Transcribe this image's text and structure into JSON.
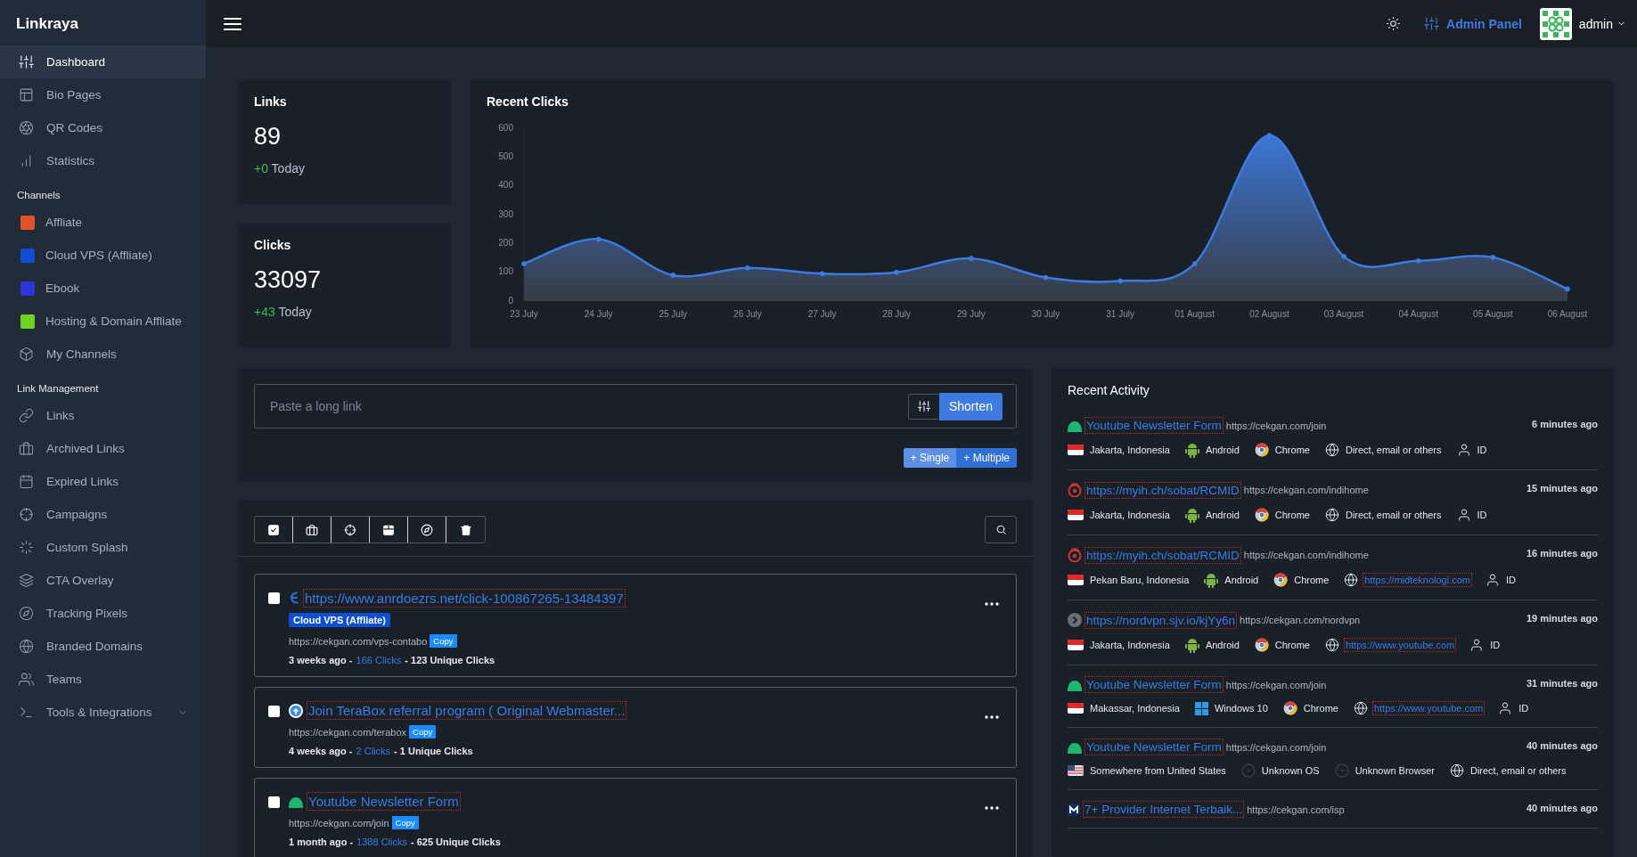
{
  "sidebar": {
    "brand": "Linkraya",
    "groups": [
      {
        "items": [
          {
            "label": "Dashboard",
            "kind": "sliders",
            "selected": true
          },
          {
            "label": "Bio Pages",
            "kind": "layout",
            "selected": false
          },
          {
            "label": "QR Codes",
            "kind": "aperture",
            "selected": false
          },
          {
            "label": "Statistics",
            "kind": "bar-chart",
            "selected": false
          }
        ]
      },
      {
        "heading": "Channels",
        "items": [
          {
            "label": "Affliate",
            "kind": "channel",
            "color": "#e0542a",
            "selected": false
          },
          {
            "label": "Cloud VPS (Affliate)",
            "kind": "channel",
            "color": "#0c4fd6",
            "selected": false
          },
          {
            "label": "Ebook",
            "kind": "channel",
            "color": "#2b35d8",
            "selected": false
          },
          {
            "label": "Hosting & Domain Affliate",
            "kind": "channel",
            "color": "#6ed321",
            "selected": false
          },
          {
            "label": "My Channels",
            "kind": "box",
            "selected": false
          }
        ]
      },
      {
        "heading": "Link Management",
        "items": [
          {
            "label": "Links",
            "kind": "link",
            "selected": false
          },
          {
            "label": "Archived Links",
            "kind": "briefcase",
            "selected": false
          },
          {
            "label": "Expired Links",
            "kind": "calendar",
            "selected": false
          },
          {
            "label": "Campaigns",
            "kind": "crosshair",
            "selected": false
          },
          {
            "label": "Custom Splash",
            "kind": "loader",
            "selected": false
          },
          {
            "label": "CTA Overlay",
            "kind": "layers",
            "selected": false
          },
          {
            "label": "Tracking Pixels",
            "kind": "compass",
            "selected": false
          },
          {
            "label": "Branded Domains",
            "kind": "globe",
            "selected": false
          },
          {
            "label": "Teams",
            "kind": "users",
            "selected": false
          },
          {
            "label": "Tools & Integrations",
            "kind": "terminal",
            "selected": false,
            "expanded": false
          }
        ]
      }
    ]
  },
  "header": {
    "admin_panel": "Admin Panel",
    "user": "admin"
  },
  "stats": [
    {
      "title": "Links",
      "value": "89",
      "delta": "+0",
      "period": "Today"
    },
    {
      "title": "Clicks",
      "value": "33097",
      "delta": "+43",
      "period": "Today"
    }
  ],
  "recent_clicks": {
    "chart_data": {
      "type": "area",
      "title": "Recent Clicks",
      "categories": [
        "23 July",
        "24 July",
        "25 July",
        "26 July",
        "27 July",
        "28 July",
        "29 July",
        "30 July",
        "31 July",
        "01 August",
        "02 August",
        "03 August",
        "04 August",
        "05 August",
        "06 August"
      ],
      "series": [
        {
          "color": "#3d7be0",
          "values": [
            130,
            215,
            90,
            115,
            95,
            100,
            148,
            82,
            70,
            130,
            575,
            155,
            140,
            152,
            42
          ]
        }
      ],
      "ylim": [
        0,
        600
      ],
      "yticks": [
        0,
        100,
        200,
        300,
        400,
        500,
        600
      ]
    }
  },
  "shortener": {
    "placeholder": "Paste a long link",
    "submit": "Shorten",
    "modes": [
      {
        "label": "+ Single",
        "selected": true
      },
      {
        "label": "+ Multiple",
        "selected": false
      }
    ]
  },
  "links": {
    "cards": [
      {
        "checked": false,
        "favicon": {
          "kind": "arc"
        },
        "title": "https://www.anrdoezrs.net/click-100867265-13484397",
        "tag": {
          "label": "Cloud VPS (Affliate)",
          "color": "#0c4fd6"
        },
        "short_url": "https://cekgan.com/vps-contabo",
        "copy": "Copy",
        "time": "3 weeks ago -",
        "clicks": "166 Clicks",
        "unique": "- 123 Unique Clicks"
      },
      {
        "checked": false,
        "favicon": {
          "kind": "cloud"
        },
        "title": "Join TeraBox referral program ( Original Webmaster...",
        "short_url": "https://cekgan.com/terabox",
        "copy": "Copy",
        "time": "4 weeks ago -",
        "clicks": "2 Clicks",
        "unique": "- 1 Unique Clicks"
      },
      {
        "checked": false,
        "favicon": {
          "kind": "dome"
        },
        "title": "Youtube Newsletter Form",
        "short_url": "https://cekgan.com/join",
        "copy": "Copy",
        "time": "1 month ago -",
        "clicks": "1388 Clicks",
        "unique": "- 625 Unique Clicks"
      }
    ]
  },
  "activity": {
    "title": "Recent Activity",
    "rows": [
      {
        "favicon": {
          "kind": "dome"
        },
        "title": "Youtube Newsletter Form",
        "short_url": "https://cekgan.com/join",
        "time": "6 minutes ago",
        "details": [
          {
            "kind": "flag-id",
            "text": "Jakarta, Indonesia"
          },
          {
            "kind": "android",
            "text": "Android"
          },
          {
            "kind": "chrome",
            "text": "Chrome"
          },
          {
            "kind": "referrer",
            "text": "Direct, email or others"
          },
          {
            "kind": "user",
            "text": "ID"
          }
        ]
      },
      {
        "favicon": {
          "kind": "target"
        },
        "title": "https://myih.ch/sobat/RCMID",
        "short_url": "https://cekgan.com/indihome",
        "time": "15 minutes ago",
        "details": [
          {
            "kind": "flag-id",
            "text": "Jakarta, Indonesia"
          },
          {
            "kind": "android",
            "text": "Android"
          },
          {
            "kind": "chrome",
            "text": "Chrome"
          },
          {
            "kind": "referrer",
            "text": "Direct, email or others"
          },
          {
            "kind": "user",
            "text": "ID"
          }
        ]
      },
      {
        "favicon": {
          "kind": "target"
        },
        "title": "https://myih.ch/sobat/RCMID",
        "short_url": "https://cekgan.com/indihome",
        "time": "16 minutes ago",
        "details": [
          {
            "kind": "flag-id",
            "text": "Pekan Baru, Indonesia"
          },
          {
            "kind": "android",
            "text": "Android"
          },
          {
            "kind": "chrome",
            "text": "Chrome"
          },
          {
            "kind": "referrer-link",
            "text": "https://midteknologi.com"
          },
          {
            "kind": "user",
            "text": "ID"
          }
        ]
      },
      {
        "favicon": {
          "kind": "chevron"
        },
        "title": "https://nordvpn.sjv.io/kjYy6n",
        "short_url": "https://cekgan.com/nordvpn",
        "time": "19 minutes ago",
        "details": [
          {
            "kind": "flag-id",
            "text": "Jakarta, Indonesia"
          },
          {
            "kind": "android",
            "text": "Android"
          },
          {
            "kind": "chrome",
            "text": "Chrome"
          },
          {
            "kind": "referrer-link",
            "text": "https://www.youtube.com"
          },
          {
            "kind": "user",
            "text": "ID"
          }
        ]
      },
      {
        "favicon": {
          "kind": "dome"
        },
        "title": "Youtube Newsletter Form",
        "short_url": "https://cekgan.com/join",
        "time": "31 minutes ago",
        "details": [
          {
            "kind": "flag-id",
            "text": "Makassar, Indonesia"
          },
          {
            "kind": "windows",
            "text": "Windows 10"
          },
          {
            "kind": "chrome",
            "text": "Chrome"
          },
          {
            "kind": "referrer-link",
            "text": "https://www.youtube.com"
          },
          {
            "kind": "user",
            "text": "ID"
          }
        ]
      },
      {
        "favicon": {
          "kind": "dome"
        },
        "title": "Youtube Newsletter Form",
        "short_url": "https://cekgan.com/join",
        "time": "40 minutes ago",
        "details": [
          {
            "kind": "flag-us",
            "text": "Somewhere from United States"
          },
          {
            "kind": "unknown",
            "text": "Unknown OS"
          },
          {
            "kind": "unknown",
            "text": "Unknown Browser"
          },
          {
            "kind": "referrer",
            "text": "Direct, email or others"
          }
        ]
      },
      {
        "favicon": {
          "kind": "square"
        },
        "title": "7+ Provider Internet Terbaik...",
        "short_url": "https://cekgan.com/isp",
        "time": "40 minutes ago"
      }
    ]
  }
}
